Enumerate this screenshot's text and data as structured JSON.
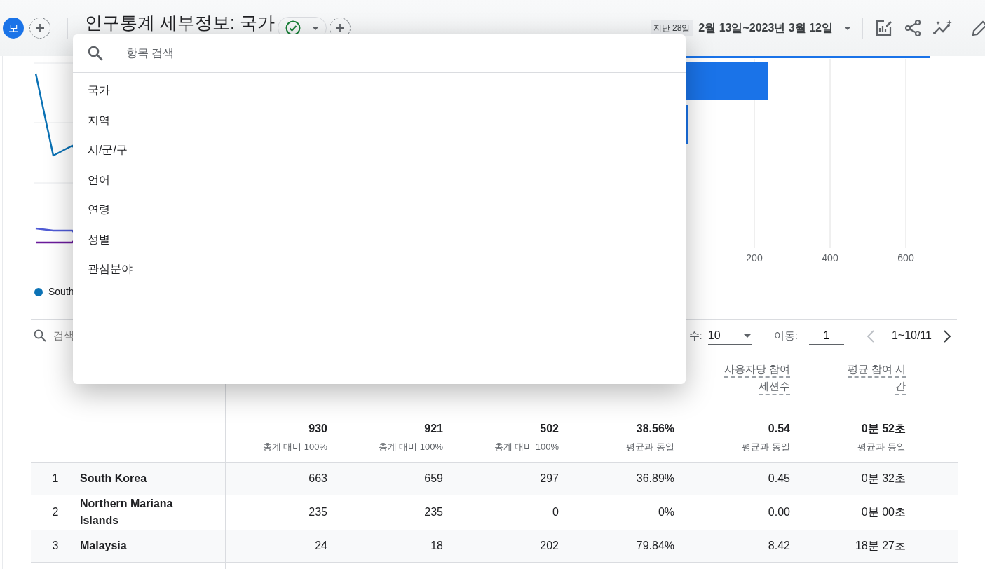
{
  "header": {
    "avatar": "모",
    "title": "인구통계 세부정보: 국가",
    "date_preset": "지난 28일",
    "date_range": "2월 13일~2023년 3월 12일"
  },
  "line_chart": {
    "legend": [
      "South"
    ]
  },
  "bar_chart": {
    "ticks": [
      "200",
      "400",
      "600"
    ]
  },
  "table_toolbar": {
    "search_placeholder": "검색",
    "rows_label": "수:",
    "rows_value": "10",
    "goto_label": "이동:",
    "goto_value": "1",
    "range": "1~10/11",
    "prev_disabled": true,
    "next_disabled": false
  },
  "table": {
    "columns": [
      {
        "total": "930",
        "total_note": "총계 대비 100%"
      },
      {
        "total": "921",
        "total_note": "총계 대비 100%"
      },
      {
        "total": "502",
        "total_note": "총계 대비 100%"
      },
      {
        "total": "38.56%",
        "total_note": "평균과 동일"
      },
      {
        "label_lines": [
          "사용자당 참여",
          "세션수"
        ],
        "total": "0.54",
        "total_note": "평균과 동일"
      },
      {
        "label_lines": [
          "평균 참여 시",
          "간"
        ],
        "total": "0분 52초",
        "total_note": "평균과 동일"
      }
    ],
    "rows": [
      {
        "rank": "1",
        "name": "South Korea",
        "values": [
          "663",
          "659",
          "297",
          "36.89%",
          "0.45",
          "0분 32초"
        ]
      },
      {
        "rank": "2",
        "name": "Northern Mariana Islands",
        "values": [
          "235",
          "235",
          "0",
          "0%",
          "0.00",
          "0분 00초"
        ]
      },
      {
        "rank": "3",
        "name": "Malaysia",
        "values": [
          "24",
          "18",
          "202",
          "79.84%",
          "8.42",
          "18분 27초"
        ]
      }
    ]
  },
  "dimension_menu": {
    "search_placeholder": "항목 검색",
    "items": [
      "국가",
      "지역",
      "시/군/구",
      "언어",
      "연령",
      "성별",
      "관심분야"
    ]
  }
}
